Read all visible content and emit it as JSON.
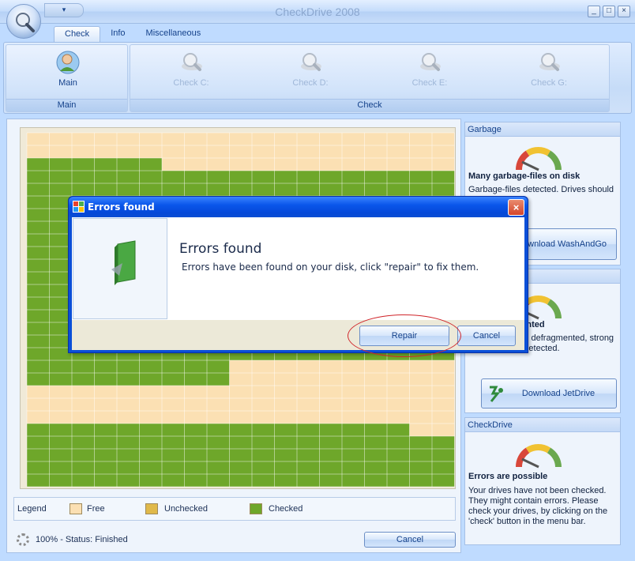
{
  "window": {
    "title": "CheckDrive 2008",
    "qat_symbol": "▾",
    "buttons": [
      "_",
      "□",
      "×"
    ]
  },
  "ribbon": {
    "tabs": [
      {
        "label": "Check",
        "active": true
      },
      {
        "label": "Info",
        "active": false
      },
      {
        "label": "Miscellaneous",
        "active": false
      }
    ],
    "groups": [
      {
        "label": "Main"
      },
      {
        "label": "Check"
      }
    ],
    "buttons": [
      {
        "label": "Main",
        "icon": "user-icon",
        "enabled": true
      },
      {
        "label": "Check C:",
        "icon": "magnifier-disk-icon",
        "enabled": false
      },
      {
        "label": "Check D:",
        "icon": "magnifier-disk-icon",
        "enabled": false
      },
      {
        "label": "Check E:",
        "icon": "magnifier-disk-icon",
        "enabled": false
      },
      {
        "label": "Check G:",
        "icon": "magnifier-disk-icon",
        "enabled": false
      }
    ]
  },
  "disk_map": {
    "colors": {
      "free": "#fbe0b3",
      "unchecked": "#e0b94a",
      "checked": "#6ea72a"
    }
  },
  "legend": {
    "title": "Legend",
    "items": [
      {
        "label": "Free",
        "color": "#fbe0b3"
      },
      {
        "label": "Unchecked",
        "color": "#e0b94a"
      },
      {
        "label": "Checked",
        "color": "#6ea72a"
      }
    ]
  },
  "status": {
    "text": "100% - Status: Finished",
    "cancel_label": "Cancel"
  },
  "panels": {
    "garbage": {
      "header": "Garbage",
      "title": "Many garbage-files on disk",
      "text": "Garbage-files detected. Drives should",
      "button_label": "Download WashAndGo"
    },
    "fragmentation": {
      "title": "Highly fragmented",
      "text_line1": "Drive should be defragmented, strong",
      "text_line2": "fragmentation detected.",
      "button_label": "Download JetDrive"
    },
    "checkdrive": {
      "header": "CheckDrive",
      "title": "Errors are possible",
      "text": "Your drives have not been checked. They might contain errors. Please check your drives, by clicking on the 'check' button in the menu bar."
    }
  },
  "dialog": {
    "title": "Errors found",
    "heading": "Errors found",
    "message": "Errors have been found on your disk, click \"repair\" to fix them.",
    "repair_label": "Repair",
    "cancel_label": "Cancel",
    "close_symbol": "×"
  }
}
